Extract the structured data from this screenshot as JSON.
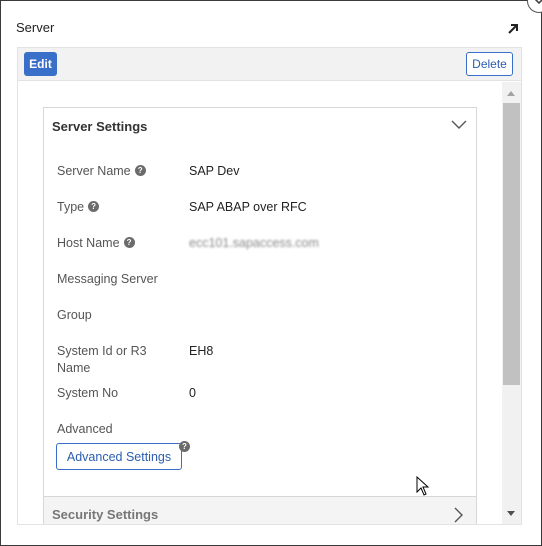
{
  "window": {
    "title": "Server"
  },
  "toolbar": {
    "edit_label": "Edit",
    "delete_label": "Delete"
  },
  "server_settings": {
    "title": "Server Settings",
    "fields": [
      {
        "label": "Server Name",
        "value": "SAP Dev",
        "has_help": true
      },
      {
        "label": "Type",
        "value": "SAP ABAP over RFC",
        "has_help": true
      },
      {
        "label": "Host Name",
        "value": "ecc101.sapaccess.com",
        "has_help": true,
        "blurred": true
      },
      {
        "label": "Messaging Server",
        "value": ""
      },
      {
        "label": "Group",
        "value": ""
      },
      {
        "label": "System Id or R3 Name",
        "value": "EH8"
      },
      {
        "label": "System No",
        "value": "0"
      },
      {
        "label": "Advanced",
        "value": ""
      }
    ],
    "advanced_button_label": "Advanced Settings"
  },
  "security_settings": {
    "title": "Security Settings"
  },
  "icons": {
    "help_glyph": "?"
  },
  "colors": {
    "primary": "#3a6fc9",
    "link": "#2a5db0"
  }
}
